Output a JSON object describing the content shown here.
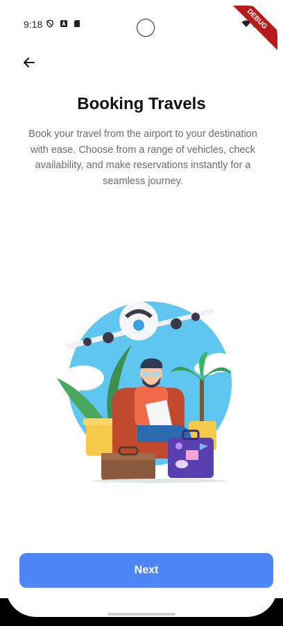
{
  "status_bar": {
    "time": "9:18",
    "icons": [
      "shield-icon",
      "a-icon",
      "sd-card-icon",
      "wifi-icon",
      "signal-icon",
      "battery-icon"
    ],
    "debug_label": "DEBUG"
  },
  "header": {
    "back_icon": "arrow-left-icon"
  },
  "main": {
    "title": "Booking Travels",
    "description": "Book your travel from the airport to your destination with ease. Choose from a range of vehicles, check availability, and make reservations instantly for a seamless journey."
  },
  "footer": {
    "next_label": "Next"
  },
  "colors": {
    "primary": "#4f86f7",
    "title": "#111111",
    "body_text": "#6b6b6b",
    "sky": "#5fc6ef"
  }
}
